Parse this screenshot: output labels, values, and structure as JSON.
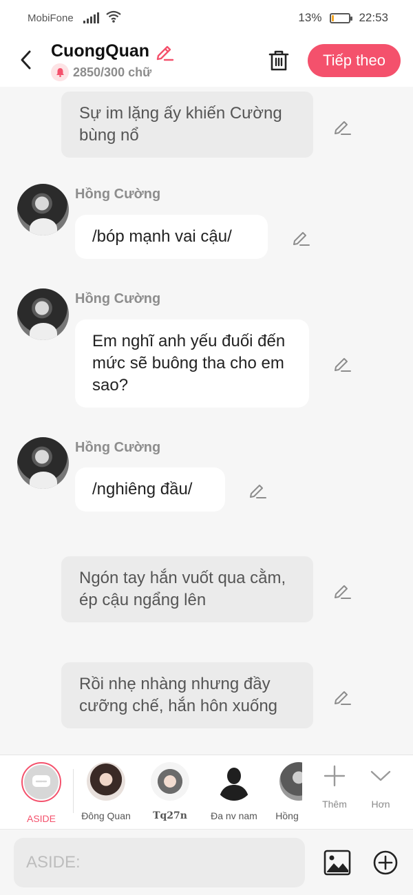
{
  "status_bar": {
    "carrier": "MobiFone",
    "battery_percent": "13%",
    "battery_level": 0.13,
    "time": "22:53"
  },
  "header": {
    "title": "CuongQuan",
    "word_count": "2850/300 chữ",
    "next_button": "Tiếp theo"
  },
  "messages": [
    {
      "type": "narration",
      "text": "Sự im lặng ấy khiến Cường bùng nổ"
    },
    {
      "type": "dialogue",
      "sender": "Hồng Cường",
      "text": "/bóp mạnh vai cậu/"
    },
    {
      "type": "dialogue",
      "sender": "Hồng Cường",
      "text": "Em nghĩ anh yếu đuối đến mức sẽ buông tha cho em sao?"
    },
    {
      "type": "dialogue",
      "sender": "Hồng Cường",
      "text": "/nghiêng đầu/"
    },
    {
      "type": "narration",
      "text": "Ngón tay hắn vuốt qua cằm, ép cậu ngẩng lên"
    },
    {
      "type": "narration",
      "text": "Rồi nhẹ nhàng nhưng đầy cưỡng chế, hắn hôn xuống"
    }
  ],
  "characters": [
    {
      "label": "ASIDE",
      "selected": true
    },
    {
      "label": "Đông Quan"
    },
    {
      "label": "Tq27n"
    },
    {
      "label": "Đa nv nam"
    },
    {
      "label": "Hồng"
    }
  ],
  "tools": {
    "add_label": "Thêm",
    "more_label": "Hơn"
  },
  "input": {
    "placeholder": "ASIDE:"
  },
  "colors": {
    "accent": "#f4516c",
    "narration_bg": "#ebebeb",
    "bubble_bg": "#ffffff",
    "chat_bg": "#f6f6f6"
  }
}
